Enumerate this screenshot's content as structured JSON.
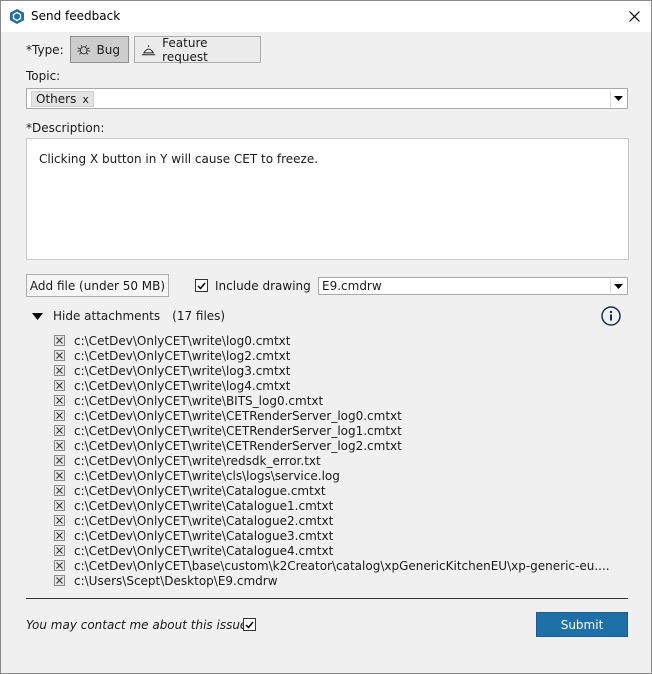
{
  "window": {
    "title": "Send feedback",
    "accent": "#1f6fa8"
  },
  "type": {
    "label": "*Type:",
    "options": [
      {
        "label": "Bug",
        "icon": "bug-icon",
        "selected": true
      },
      {
        "label": "Feature request",
        "icon": "lamp-icon",
        "selected": false
      }
    ]
  },
  "topic": {
    "label": "Topic:",
    "tags": [
      "Others"
    ],
    "tag_remove": "x"
  },
  "description": {
    "label": "*Description:",
    "value": "Clicking X button in Y will cause CET to freeze."
  },
  "attachments_bar": {
    "add_file_label": "Add file (under 50 MB)",
    "include_drawing_label": "Include drawing",
    "include_drawing_checked": true,
    "drawing_file": "E9.cmdrw"
  },
  "attachments": {
    "toggle_label": "Hide attachments",
    "count_label": "(17 files)",
    "files": [
      "c:\\CetDev\\OnlyCET\\write\\log0.cmtxt",
      "c:\\CetDev\\OnlyCET\\write\\log2.cmtxt",
      "c:\\CetDev\\OnlyCET\\write\\log3.cmtxt",
      "c:\\CetDev\\OnlyCET\\write\\log4.cmtxt",
      "c:\\CetDev\\OnlyCET\\write\\BITS_log0.cmtxt",
      "c:\\CetDev\\OnlyCET\\write\\CETRenderServer_log0.cmtxt",
      "c:\\CetDev\\OnlyCET\\write\\CETRenderServer_log1.cmtxt",
      "c:\\CetDev\\OnlyCET\\write\\CETRenderServer_log2.cmtxt",
      "c:\\CetDev\\OnlyCET\\write\\redsdk_error.txt",
      "c:\\CetDev\\OnlyCET\\write\\cls\\logs\\service.log",
      "c:\\CetDev\\OnlyCET\\write\\Catalogue.cmtxt",
      "c:\\CetDev\\OnlyCET\\write\\Catalogue1.cmtxt",
      "c:\\CetDev\\OnlyCET\\write\\Catalogue2.cmtxt",
      "c:\\CetDev\\OnlyCET\\write\\Catalogue3.cmtxt",
      "c:\\CetDev\\OnlyCET\\write\\Catalogue4.cmtxt",
      "c:\\CetDev\\OnlyCET\\base\\custom\\k2Creator\\catalog\\xpGenericKitchenEU\\xp-generic-eu....",
      "c:\\Users\\Scept\\Desktop\\E9.cmdrw"
    ]
  },
  "footer": {
    "contact_label": "You may contact me about this issue",
    "contact_checked": true,
    "submit_label": "Submit"
  }
}
